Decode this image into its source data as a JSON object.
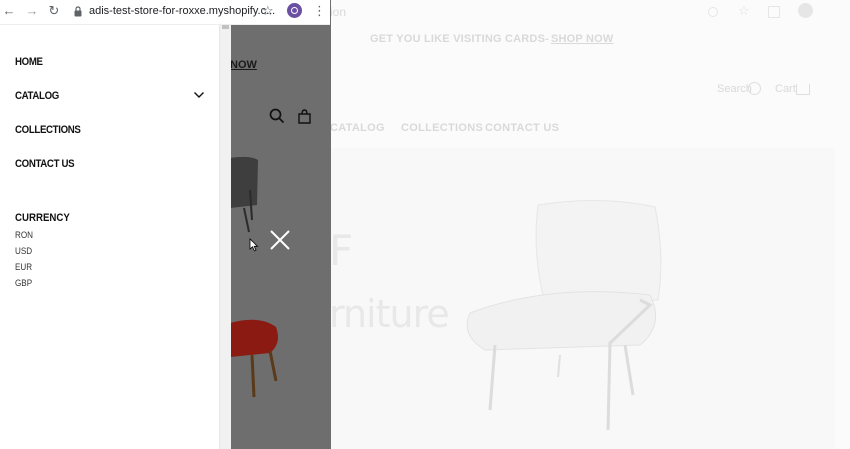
{
  "browser": {
    "url": "adis-test-store-for-roxxe.myshopify.c...",
    "icons": [
      "back-icon",
      "forward-icon",
      "reload-icon",
      "lock-icon",
      "star-icon",
      "extension-icon",
      "menu-icon"
    ]
  },
  "background": {
    "url_fragment": "ion",
    "announcement_text": "GET YOU LIKE VISITING CARDS-",
    "announcement_link": "SHOP NOW",
    "search_label": "Search",
    "cart_label": "Cart",
    "nav": [
      "CATALOG",
      "COLLECTIONS",
      "CONTACT US"
    ],
    "hero_line_1": "F",
    "hero_line_2": "rniture"
  },
  "overlay": {
    "announcement_link_fragment": "NOW",
    "color": "#6e6e6e"
  },
  "drawer": {
    "menu": [
      {
        "label": "HOME"
      },
      {
        "label": "CATALOG",
        "has_submenu": true
      },
      {
        "label": "COLLECTIONS"
      },
      {
        "label": "CONTACT US"
      }
    ],
    "currency": {
      "heading": "CURRENCY",
      "options": [
        "RON",
        "USD",
        "EUR",
        "GBP"
      ]
    }
  },
  "colors": {
    "drawer_bg": "#ffffff",
    "text": "#111111",
    "extension_purple": "#6a4fa3",
    "red_chair": "#8b1a12"
  }
}
